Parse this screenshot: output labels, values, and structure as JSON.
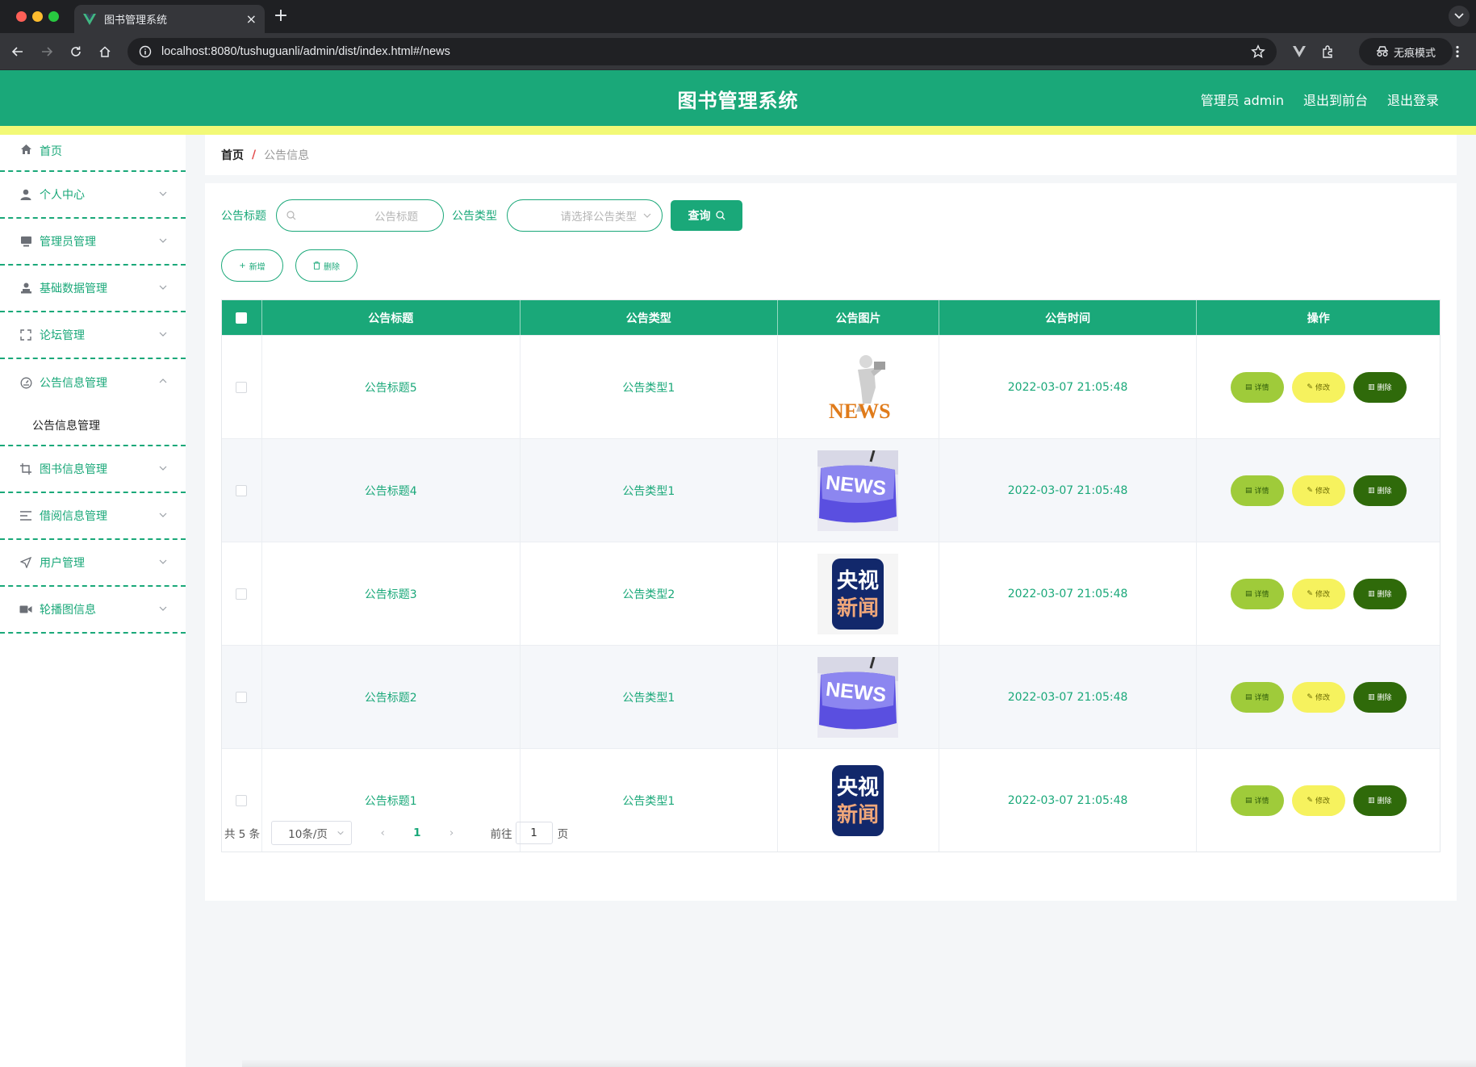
{
  "browser": {
    "tab_title": "图书管理系统",
    "url": "localhost:8080/tushuguanli/admin/dist/index.html#/news",
    "incognito_label": "无痕模式"
  },
  "header": {
    "title": "图书管理系统",
    "admin_label": "管理员 admin",
    "to_front_label": "退出到前台",
    "logout_label": "退出登录"
  },
  "sidebar": {
    "items": [
      {
        "label": "首页",
        "icon": "home-icon"
      },
      {
        "label": "个人中心",
        "icon": "user-icon"
      },
      {
        "label": "管理员管理",
        "icon": "monitor-icon"
      },
      {
        "label": "基础数据管理",
        "icon": "person-stand-icon"
      },
      {
        "label": "论坛管理",
        "icon": "fullscreen-icon"
      },
      {
        "label": "公告信息管理",
        "icon": "gauge-icon",
        "expanded": true,
        "children": [
          "公告信息管理"
        ]
      },
      {
        "label": "图书信息管理",
        "icon": "crop-icon"
      },
      {
        "label": "借阅信息管理",
        "icon": "list-icon"
      },
      {
        "label": "用户管理",
        "icon": "send-icon"
      },
      {
        "label": "轮播图信息",
        "icon": "video-camera-icon"
      }
    ]
  },
  "breadcrumb": {
    "home": "首页",
    "separator": "/",
    "current": "公告信息"
  },
  "search": {
    "title_label": "公告标题",
    "title_placeholder": "公告标题",
    "type_label": "公告类型",
    "type_placeholder": "请选择公告类型",
    "query_label": "查询"
  },
  "actions": {
    "add_label": "新增",
    "delete_label": "删除"
  },
  "table": {
    "headers": [
      "公告标题",
      "公告类型",
      "公告图片",
      "公告时间",
      "操作"
    ],
    "rows": [
      {
        "title": "公告标题5",
        "type": "公告类型1",
        "image": "news-3d-figure",
        "time": "2022-03-07 21:05:48"
      },
      {
        "title": "公告标题4",
        "type": "公告类型1",
        "image": "news-keyboard-key",
        "time": "2022-03-07 21:05:48"
      },
      {
        "title": "公告标题3",
        "type": "公告类型2",
        "image": "cctv-news-logo",
        "time": "2022-03-07 21:05:48"
      },
      {
        "title": "公告标题2",
        "type": "公告类型1",
        "image": "news-keyboard-key",
        "time": "2022-03-07 21:05:48"
      },
      {
        "title": "公告标题1",
        "type": "公告类型1",
        "image": "cctv-news-logo",
        "time": "2022-03-07 21:05:48"
      }
    ],
    "ops": {
      "detail": "详情",
      "edit": "修改",
      "delete": "删除"
    },
    "thumb_text": {
      "news": "NEWS",
      "cctv_line1": "央视",
      "cctv_line2": "新闻"
    }
  },
  "pagination": {
    "total_label": "共 5 条",
    "page_size": "10条/页",
    "current_page": "1",
    "goto_label": "前往",
    "goto_value": "1",
    "page_suffix": "页"
  },
  "colors": {
    "primary": "#1aa879",
    "yellow_band": "#f2f976",
    "detail_btn": "#9fcb3a",
    "edit_btn": "#f6f25e",
    "delete_btn": "#2f6a0a"
  }
}
